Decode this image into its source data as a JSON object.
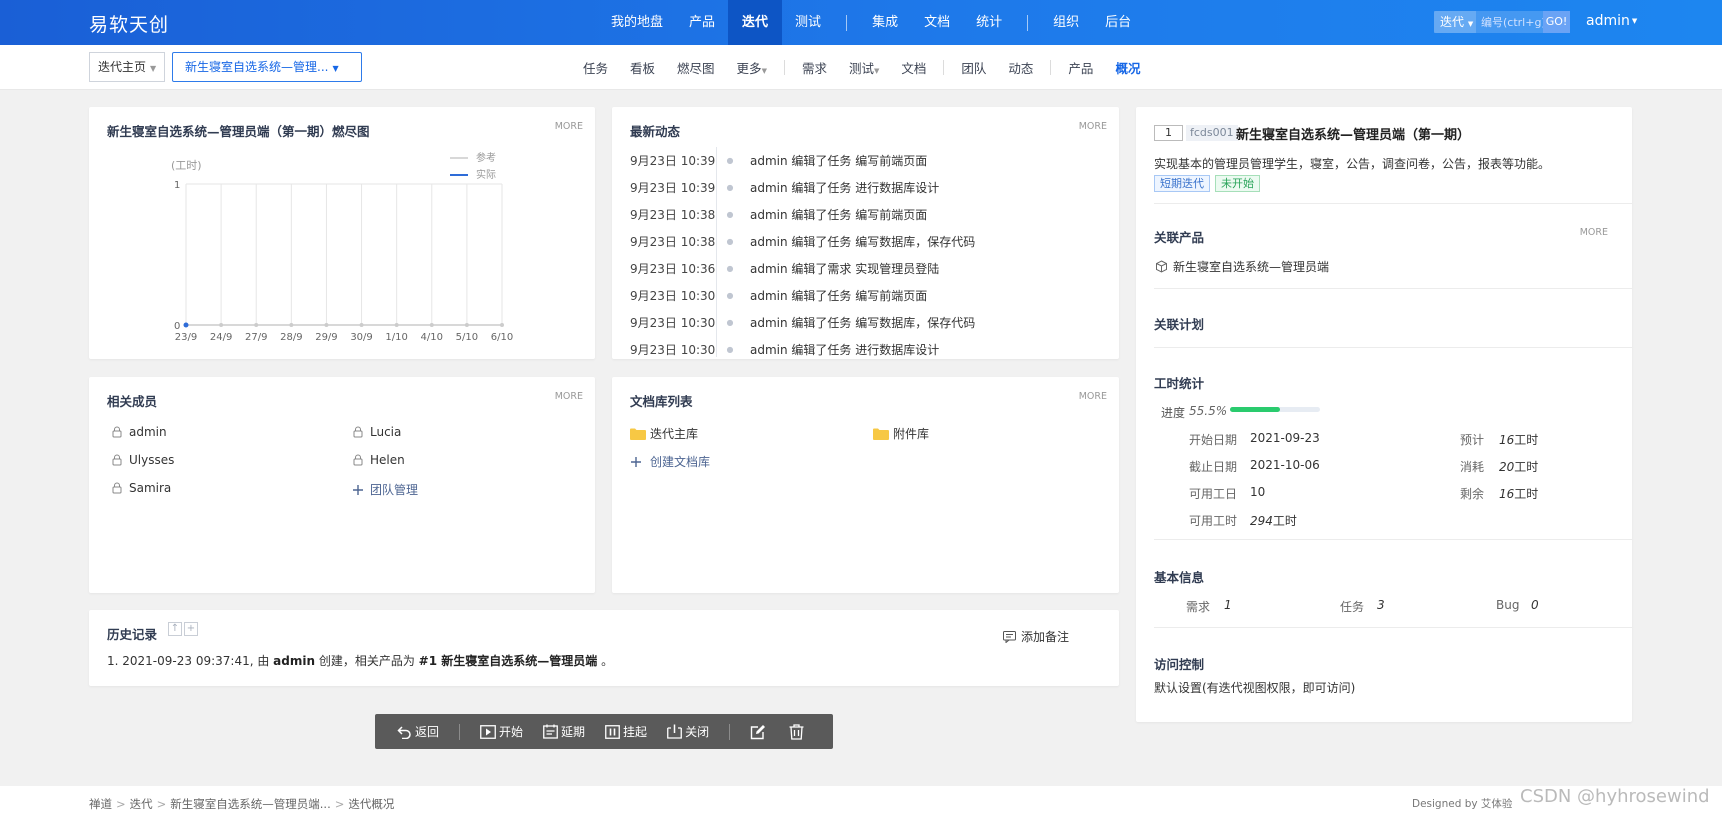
{
  "app": {
    "logo": "易软天创"
  },
  "main_nav": [
    {
      "label": "我的地盘",
      "active": false
    },
    {
      "label": "产品",
      "active": false
    },
    {
      "label": "迭代",
      "active": true
    },
    {
      "label": "测试",
      "active": false
    },
    {
      "label": "集成",
      "active": false
    },
    {
      "label": "文档",
      "active": false
    },
    {
      "label": "统计",
      "active": false
    },
    {
      "label": "组织",
      "active": false
    },
    {
      "label": "后台",
      "active": false
    }
  ],
  "search": {
    "type": "迭代",
    "placeholder": "编号(ctrl+g)",
    "go": "GO!"
  },
  "user": {
    "name": "admin"
  },
  "breadcrumb": {
    "home": "迭代主页",
    "execution": "新生寝室自选系统—管理..."
  },
  "sub_nav": [
    {
      "label": "任务",
      "active": false
    },
    {
      "label": "看板",
      "active": false
    },
    {
      "label": "燃尽图",
      "active": false
    },
    {
      "label": "更多",
      "active": false
    },
    {
      "label": "需求",
      "active": false
    },
    {
      "label": "测试",
      "active": false
    },
    {
      "label": "文档",
      "active": false
    },
    {
      "label": "团队",
      "active": false
    },
    {
      "label": "动态",
      "active": false
    },
    {
      "label": "产品",
      "active": false
    },
    {
      "label": "概况",
      "active": true
    }
  ],
  "burndown": {
    "title": "新生寝室自选系统—管理员端（第一期）燃尽图",
    "more": "MORE",
    "unit": "(工时)",
    "legend": [
      "参考",
      "实际"
    ]
  },
  "chart_data": {
    "type": "line",
    "x": [
      "23/9",
      "24/9",
      "27/9",
      "28/9",
      "29/9",
      "30/9",
      "1/10",
      "4/10",
      "5/10",
      "6/10"
    ],
    "ylim": [
      0,
      1
    ],
    "yticks": [
      0,
      1
    ],
    "ylabel": "(工时)",
    "series": [
      {
        "name": "参考",
        "values": [
          0,
          0,
          0,
          0,
          0,
          0,
          0,
          0,
          0,
          0
        ],
        "color": "#cccccc"
      },
      {
        "name": "实际",
        "values": [
          0
        ],
        "color": "#2e6cd8"
      }
    ],
    "legend_position": "top-right",
    "grid": true
  },
  "dynamics": {
    "title": "最新动态",
    "more": "MORE",
    "items": [
      {
        "time": "9月23日 10:39",
        "text": "admin 编辑了任务 编写前端页面"
      },
      {
        "time": "9月23日 10:39",
        "text": "admin 编辑了任务 进行数据库设计"
      },
      {
        "time": "9月23日 10:38",
        "text": "admin 编辑了任务 编写前端页面"
      },
      {
        "time": "9月23日 10:38",
        "text": "admin 编辑了任务 编写数据库，保存代码"
      },
      {
        "time": "9月23日 10:36",
        "text": "admin 编辑了需求 实现管理员登陆"
      },
      {
        "time": "9月23日 10:30",
        "text": "admin 编辑了任务 编写前端页面"
      },
      {
        "time": "9月23日 10:30",
        "text": "admin 编辑了任务 编写数据库，保存代码"
      },
      {
        "time": "9月23日 10:30",
        "text": "admin 编辑了任务 进行数据库设计"
      }
    ]
  },
  "members": {
    "title": "相关成员",
    "more": "MORE",
    "names": [
      "admin",
      "Lucia",
      "Ulysses",
      "Helen",
      "Samira"
    ],
    "team_manage": "团队管理"
  },
  "doclibs": {
    "title": "文档库列表",
    "more": "MORE",
    "libs": [
      "迭代主库",
      "附件库"
    ],
    "create": "创建文档库"
  },
  "history": {
    "title": "历史记录",
    "add_note": "添加备注",
    "entry_prefix": "1. 2021-09-23 09:37:41, 由 ",
    "entry_user": "admin",
    "entry_mid": " 创建，相关产品为 ",
    "entry_product": "#1 新生寝室自选系统—管理员端",
    "entry_suffix": " 。"
  },
  "info": {
    "number": "1",
    "code": "fcds001",
    "name": "新生寝室自选系统—管理员端（第一期）",
    "desc": "实现基本的管理员管理学生，寝室，公告，调查问卷，公告，报表等功能。",
    "tag_type": "短期迭代",
    "tag_status": "未开始",
    "linked_product_title": "关联产品",
    "linked_product_more": "MORE",
    "linked_product": "新生寝室自选系统—管理员端",
    "linked_plan_title": "关联计划",
    "workhour_title": "工时统计",
    "progress_label": "进度",
    "progress_text": "55.5%",
    "progress_value": 0.555,
    "start_label": "开始日期",
    "start": "2021-09-23",
    "end_label": "截止日期",
    "end": "2021-10-06",
    "workdays_label": "可用工日",
    "workdays": "10",
    "workhours_label": "可用工时",
    "workhours_num": "294",
    "workhours_unit": "工时",
    "estimate_label": "预计",
    "estimate_num": "16",
    "estimate_unit": "工时",
    "consumed_label": "消耗",
    "consumed_num": "20",
    "consumed_unit": "工时",
    "left_label": "剩余",
    "left_num": "16",
    "left_unit": "工时",
    "basic_title": "基本信息",
    "story_label": "需求",
    "story": "1",
    "task_label": "任务",
    "task": "3",
    "bug_label": "Bug",
    "bug": "0",
    "acl_title": "访问控制",
    "acl": "默认设置(有迭代视图权限，即可访问)"
  },
  "toolbar": {
    "back": "返回",
    "start": "开始",
    "delay": "延期",
    "suspend": "挂起",
    "close": "关闭"
  },
  "footer": {
    "crumbs": [
      "禅道",
      "迭代",
      "新生寝室自选系统—管理员端...",
      "迭代概况"
    ],
    "designed_by": "Designed by 艾体验",
    "watermark": "CSDN @hyhrosewind"
  }
}
